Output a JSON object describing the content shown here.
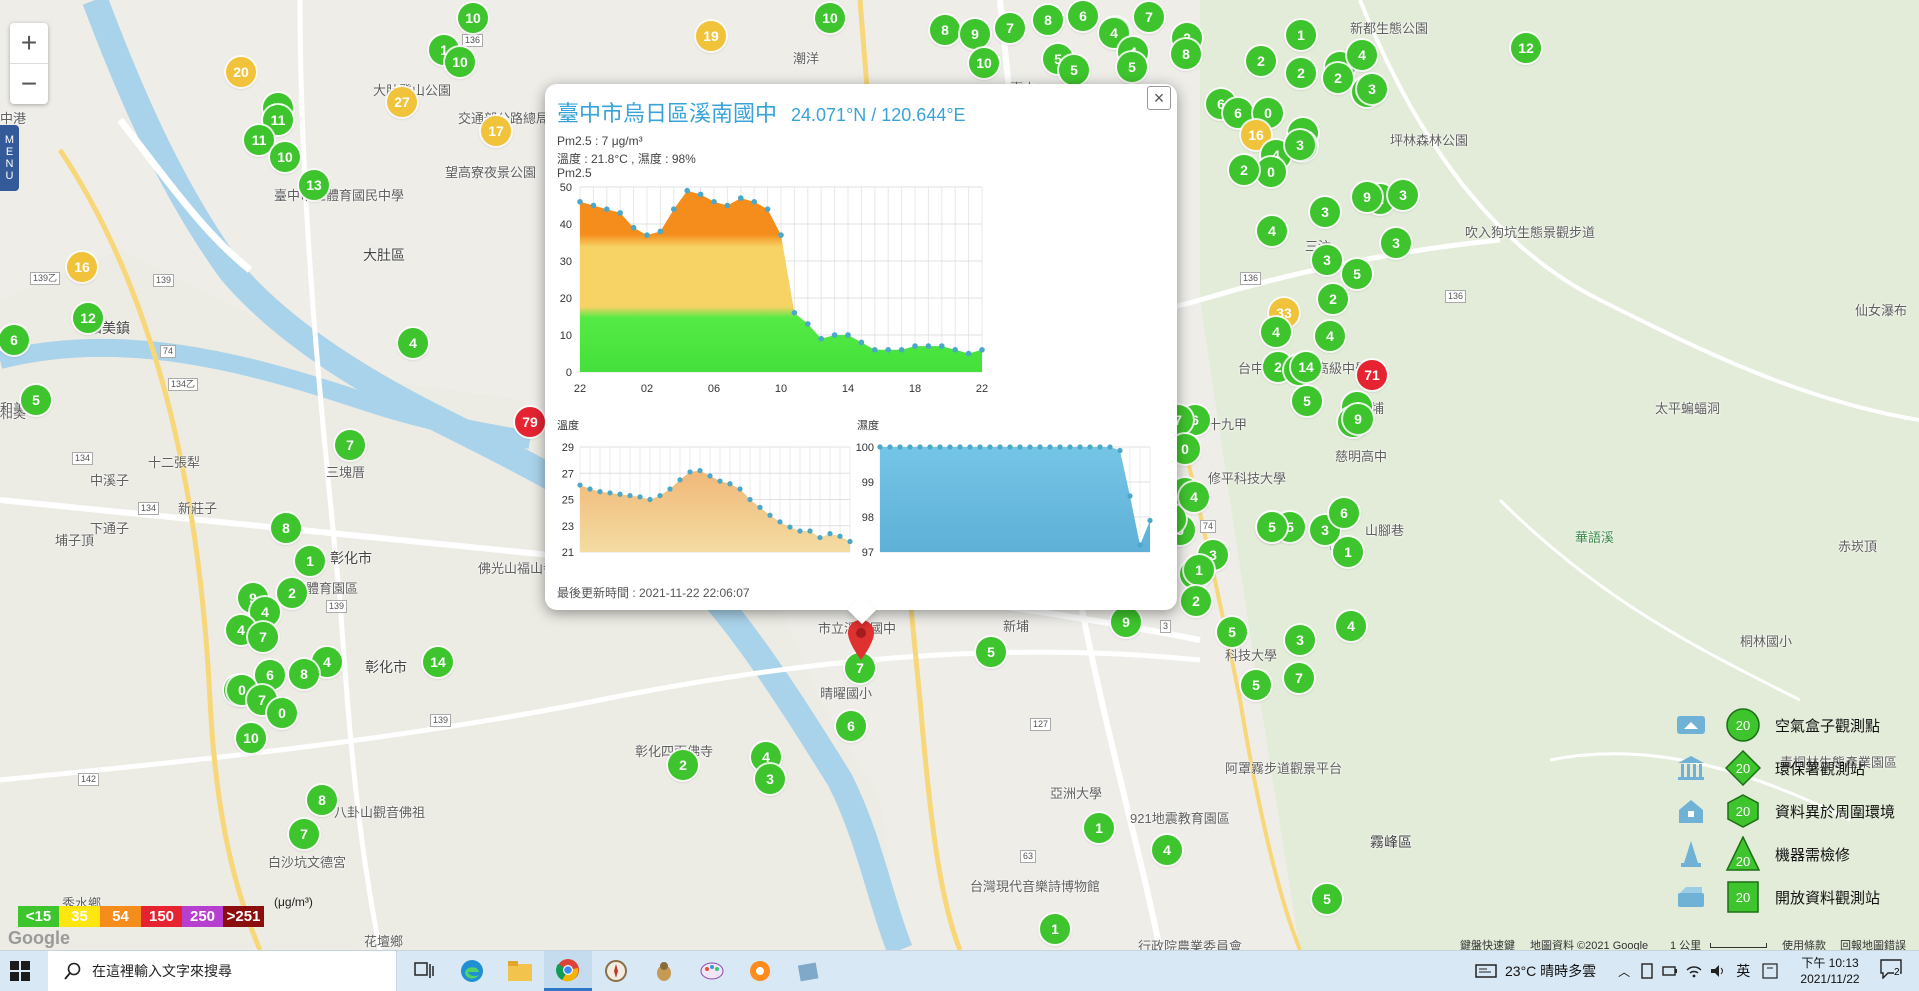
{
  "map": {
    "places": [
      {
        "id": "fuhua",
        "text": "新都生態公園"
      },
      {
        "id": "dadu_park",
        "text": "大肚登山公園"
      },
      {
        "id": "jiaotong",
        "text": "交通部公路總局"
      },
      {
        "id": "wangao",
        "text": "望高寮夜景公園"
      },
      {
        "id": "taichung_stadium",
        "text": "臺中市立體育國民中學"
      },
      {
        "id": "dadu",
        "text": "大肚區"
      },
      {
        "id": "hemei",
        "text": "和美鎮"
      },
      {
        "id": "hemei2",
        "text": "和美"
      },
      {
        "id": "puxing",
        "text": "十二張犁"
      },
      {
        "id": "shanglou",
        "text": "中溪子"
      },
      {
        "id": "xinzhuang",
        "text": "新莊子"
      },
      {
        "id": "xiamen",
        "text": "下通子"
      },
      {
        "id": "puzai",
        "text": "埔子頂"
      },
      {
        "id": "changhua",
        "text": "彰化市"
      },
      {
        "id": "changhua2",
        "text": "彰化市"
      },
      {
        "id": "changhua_gym",
        "text": "彰化體育園區"
      },
      {
        "id": "sanhe",
        "text": "三塊厝"
      },
      {
        "id": "foguang",
        "text": "佛光山福山寺"
      },
      {
        "id": "changhua_temple",
        "text": "彰化四面佛寺"
      },
      {
        "id": "bagua",
        "text": "八卦山觀音佛祖"
      },
      {
        "id": "baisha",
        "text": "白沙坑文德宮"
      },
      {
        "id": "huatan",
        "text": "花壇鄉"
      },
      {
        "id": "xiushui",
        "text": "秀水鄉"
      },
      {
        "id": "xinan",
        "text": "市立溪南國中"
      },
      {
        "id": "xinpu",
        "text": "新埔"
      },
      {
        "id": "qingguang",
        "text": "晴曜國小"
      },
      {
        "id": "asia",
        "text": "亞洲大學"
      },
      {
        "id": "quake",
        "text": "921地震教育園區"
      },
      {
        "id": "museum",
        "text": "台灣現代音樂詩博物館"
      },
      {
        "id": "agri",
        "text": "行政院農業委員會"
      },
      {
        "id": "wufeng",
        "text": "霧峰區"
      },
      {
        "id": "afeng",
        "text": "阿罩霧步道觀景平台"
      },
      {
        "id": "qingtong",
        "text": "青桐林生態產業園區"
      },
      {
        "id": "gangzi",
        "text": "桐林國小"
      },
      {
        "id": "keji",
        "text": "科技大學"
      },
      {
        "id": "taiping",
        "text": "太平蝙蝠洞"
      },
      {
        "id": "xianlai",
        "text": "仙女瀑布"
      },
      {
        "id": "chixi",
        "text": "赤崁頂"
      },
      {
        "id": "shanjiao",
        "text": "山腳巷"
      },
      {
        "id": "ciming",
        "text": "慈明高中"
      },
      {
        "id": "chegang",
        "text": "車籠埔"
      },
      {
        "id": "shijiu",
        "text": "十九甲"
      },
      {
        "id": "xiuping",
        "text": "修平科技大學"
      },
      {
        "id": "taizhong_high",
        "text": "台中市立大里高級中學"
      },
      {
        "id": "pinglin",
        "text": "坪林森林公園"
      },
      {
        "id": "sanfen",
        "text": "三汴"
      },
      {
        "id": "gougou",
        "text": "吹入狗坑生態景觀步道"
      },
      {
        "id": "taichung_city",
        "text": "臺中"
      },
      {
        "id": "chao",
        "text": "潮洋"
      },
      {
        "id": "zhongzhang",
        "text": "中港"
      },
      {
        "id": "heba",
        "text": "和美"
      },
      {
        "id": "lushui",
        "text": "華語溪"
      },
      {
        "id": "hailu",
        "text": "和美"
      }
    ],
    "markers": [
      {
        "v": "10",
        "c": "g"
      },
      {
        "v": "1",
        "c": "g"
      },
      {
        "v": "10",
        "c": "g"
      },
      {
        "v": "19",
        "c": "y"
      },
      {
        "v": "20",
        "c": "y"
      },
      {
        "v": "27",
        "c": "y"
      },
      {
        "v": "17",
        "c": "y"
      },
      {
        "v": "11",
        "c": "g"
      },
      {
        "v": "11",
        "c": "g"
      },
      {
        "v": "11",
        "c": "g"
      },
      {
        "v": "10",
        "c": "g"
      },
      {
        "v": "13",
        "c": "g"
      },
      {
        "v": "16",
        "c": "y"
      },
      {
        "v": "12",
        "c": "g"
      },
      {
        "v": "6",
        "c": "g"
      },
      {
        "v": "5",
        "c": "g"
      },
      {
        "v": "4",
        "c": "g"
      },
      {
        "v": "79",
        "c": "r"
      },
      {
        "v": "7",
        "c": "g"
      },
      {
        "v": "8",
        "c": "g"
      },
      {
        "v": "1",
        "c": "g"
      },
      {
        "v": "9",
        "c": "g"
      },
      {
        "v": "2",
        "c": "g"
      },
      {
        "v": "4",
        "c": "g"
      },
      {
        "v": "4",
        "c": "g"
      },
      {
        "v": "7",
        "c": "g"
      },
      {
        "v": "4",
        "c": "g"
      },
      {
        "v": "6",
        "c": "g"
      },
      {
        "v": "4",
        "c": "g"
      },
      {
        "v": "8",
        "c": "g"
      },
      {
        "v": "0",
        "c": "g"
      },
      {
        "v": "7",
        "c": "g"
      },
      {
        "v": "0",
        "c": "g"
      },
      {
        "v": "10",
        "c": "g"
      },
      {
        "v": "14",
        "c": "g"
      },
      {
        "v": "8",
        "c": "g"
      },
      {
        "v": "7",
        "c": "g"
      },
      {
        "v": "2",
        "c": "g"
      },
      {
        "v": "4",
        "c": "g"
      },
      {
        "v": "3",
        "c": "g"
      },
      {
        "v": "6",
        "c": "g"
      },
      {
        "v": "7",
        "c": "g"
      },
      {
        "v": "5",
        "c": "g"
      },
      {
        "v": "9",
        "c": "g"
      },
      {
        "v": "1",
        "c": "g"
      },
      {
        "v": "4",
        "c": "g"
      },
      {
        "v": "5",
        "c": "g"
      },
      {
        "v": "1",
        "c": "g"
      },
      {
        "v": "10",
        "c": "g"
      },
      {
        "v": "8",
        "c": "g"
      },
      {
        "v": "9",
        "c": "g"
      },
      {
        "v": "7",
        "c": "g"
      },
      {
        "v": "8",
        "c": "g"
      },
      {
        "v": "6",
        "c": "g"
      },
      {
        "v": "9",
        "c": "g"
      },
      {
        "v": "7",
        "c": "g"
      },
      {
        "v": "10",
        "c": "g"
      },
      {
        "v": "5",
        "c": "g"
      },
      {
        "v": "5",
        "c": "g"
      },
      {
        "v": "4",
        "c": "g"
      },
      {
        "v": "4",
        "c": "g"
      },
      {
        "v": "5",
        "c": "g"
      },
      {
        "v": "2",
        "c": "g"
      },
      {
        "v": "8",
        "c": "g"
      },
      {
        "v": "2",
        "c": "g"
      },
      {
        "v": "1",
        "c": "g"
      },
      {
        "v": "2",
        "c": "g"
      },
      {
        "v": "3",
        "c": "g"
      },
      {
        "v": "4",
        "c": "g"
      },
      {
        "v": "12",
        "c": "g"
      },
      {
        "v": "6",
        "c": "g"
      },
      {
        "v": "6",
        "c": "g"
      },
      {
        "v": "0",
        "c": "g"
      },
      {
        "v": "0",
        "c": "g"
      },
      {
        "v": "16",
        "c": "y"
      },
      {
        "v": "0",
        "c": "g"
      },
      {
        "v": "4",
        "c": "g"
      },
      {
        "v": "4",
        "c": "g"
      },
      {
        "v": "3",
        "c": "g"
      },
      {
        "v": "2",
        "c": "g"
      },
      {
        "v": "0",
        "c": "g"
      },
      {
        "v": "2",
        "c": "g"
      },
      {
        "v": "3",
        "c": "g"
      },
      {
        "v": "4",
        "c": "g"
      },
      {
        "v": "33",
        "c": "y"
      },
      {
        "v": "4",
        "c": "g"
      },
      {
        "v": "3",
        "c": "g"
      },
      {
        "v": "2",
        "c": "g"
      },
      {
        "v": "9",
        "c": "g"
      },
      {
        "v": "3",
        "c": "g"
      },
      {
        "v": "3",
        "c": "g"
      },
      {
        "v": "5",
        "c": "g"
      },
      {
        "v": "2",
        "c": "g"
      },
      {
        "v": "2",
        "c": "g"
      },
      {
        "v": "3",
        "c": "g"
      },
      {
        "v": "4",
        "c": "g"
      },
      {
        "v": "3",
        "c": "g"
      },
      {
        "v": "4",
        "c": "g"
      },
      {
        "v": "14",
        "c": "g"
      },
      {
        "v": "4",
        "c": "g"
      },
      {
        "v": "71",
        "c": "r"
      },
      {
        "v": "5",
        "c": "g"
      },
      {
        "v": "6",
        "c": "g"
      },
      {
        "v": "7",
        "c": "g"
      },
      {
        "v": "0",
        "c": "g"
      },
      {
        "v": "4",
        "c": "g"
      },
      {
        "v": "5",
        "c": "g"
      },
      {
        "v": "6",
        "c": "g"
      },
      {
        "v": "3",
        "c": "g"
      },
      {
        "v": "5",
        "c": "g"
      },
      {
        "v": "3",
        "c": "g"
      },
      {
        "v": "3",
        "c": "g"
      },
      {
        "v": "4",
        "c": "g"
      },
      {
        "v": "1",
        "c": "g"
      },
      {
        "v": "5",
        "c": "g"
      },
      {
        "v": "5",
        "c": "g"
      },
      {
        "v": "1",
        "c": "g"
      },
      {
        "v": "2",
        "c": "g"
      },
      {
        "v": "5",
        "c": "g"
      },
      {
        "v": "4",
        "c": "g"
      },
      {
        "v": "3",
        "c": "g"
      },
      {
        "v": "6",
        "c": "g"
      },
      {
        "v": "5",
        "c": "g"
      },
      {
        "v": "7",
        "c": "g"
      },
      {
        "v": "9",
        "c": "g"
      },
      {
        "v": "4",
        "c": "g"
      },
      {
        "v": "3",
        "c": "g"
      },
      {
        "v": "5",
        "c": "g"
      }
    ],
    "road_numbers": [
      "136",
      "139",
      "136",
      "134",
      "134",
      "142",
      "139",
      "127",
      "129",
      "136",
      "136",
      "139乙",
      "134乙",
      "74",
      "74",
      "63",
      "3",
      "139"
    ]
  },
  "zoom": {
    "in": "+",
    "out": "−"
  },
  "menu": {
    "label": "MENU"
  },
  "popup": {
    "title": "臺中市烏日區溪南國中",
    "coords": "24.071°N / 120.644°E",
    "pm25_line": "Pm2.5 : 7 μg/m³",
    "temp_humid_line": "溫度 : 21.8°C , 濕度 : 98%",
    "chart_label": "Pm2.5",
    "temp_label": "溫度",
    "humid_label": "濕度",
    "updated": "最後更新時間 : 2021-11-22 22:06:07",
    "close": "×"
  },
  "chart_data": [
    {
      "type": "area",
      "title": "Pm2.5",
      "x_tick_labels": [
        "22",
        "02",
        "06",
        "10",
        "14",
        "18",
        "22"
      ],
      "ylim": [
        0,
        50
      ],
      "y_ticks": [
        0,
        10,
        20,
        30,
        40,
        50
      ],
      "grid": true,
      "series": [
        {
          "values": [
            46,
            45,
            44,
            43,
            39,
            37,
            38,
            44,
            49,
            48,
            46,
            45,
            47,
            46,
            44,
            37,
            16,
            13,
            9,
            10,
            10,
            8,
            6,
            6,
            6,
            7,
            7,
            7,
            6,
            5,
            6
          ]
        }
      ]
    },
    {
      "type": "area",
      "title": "溫度",
      "ylim": [
        21,
        29
      ],
      "y_ticks": [
        21,
        23,
        25,
        27,
        29
      ],
      "grid": true,
      "series": [
        {
          "values": [
            26.1,
            25.8,
            25.6,
            25.5,
            25.4,
            25.3,
            25.2,
            25,
            25.3,
            25.8,
            26.5,
            27.1,
            27.2,
            26.8,
            26.4,
            26.2,
            25.8,
            25,
            24.4,
            23.8,
            23.3,
            22.9,
            22.6,
            22.6,
            22.1,
            22.4,
            22.2,
            21.8
          ]
        }
      ]
    },
    {
      "type": "area",
      "title": "濕度",
      "ylim": [
        97,
        100
      ],
      "y_ticks": [
        97,
        98,
        99,
        100
      ],
      "grid": true,
      "series": [
        {
          "values": [
            100,
            100,
            100,
            100,
            100,
            100,
            100,
            100,
            100,
            100,
            100,
            100,
            100,
            100,
            100,
            100,
            100,
            100,
            100,
            100,
            100,
            100,
            100,
            100,
            99.9,
            98.6,
            97.2,
            97.9
          ]
        }
      ]
    }
  ],
  "legend_bar": [
    {
      "label": "<15",
      "color": "#3ec52d"
    },
    {
      "label": "35",
      "color": "#ffe60f"
    },
    {
      "label": "54",
      "color": "#f58d1c"
    },
    {
      "label": "150",
      "color": "#e52331"
    },
    {
      "label": "250",
      "color": "#b73fcf"
    },
    {
      "label": ">251",
      "color": "#8c0d0d"
    }
  ],
  "legend_unit": "(μg/m³)",
  "google_logo": "Google",
  "key": [
    {
      "label": "空氣盒子觀測點",
      "value": "20",
      "shape": "circle"
    },
    {
      "label": "環保署觀測站",
      "value": "20",
      "shape": "diamond"
    },
    {
      "label": "資料異於周圍環境",
      "value": "20",
      "shape": "hexagon"
    },
    {
      "label": "機器需檢修",
      "value": "20",
      "shape": "triangle"
    },
    {
      "label": "開放資料觀測站",
      "value": "20",
      "shape": "square"
    }
  ],
  "attribution": {
    "shortcuts": "鍵盤快速鍵",
    "mapdata": "地圖資料 ©2021 Google",
    "scale": "1 公里",
    "terms": "使用條款",
    "report": "回報地圖錯誤"
  },
  "taskbar": {
    "search_placeholder": "在這裡輸入文字來搜尋",
    "weather": "23°C  晴時多雲",
    "ime": "英",
    "time": "下午 10:13",
    "date": "2021/11/22",
    "notifications": "2"
  }
}
